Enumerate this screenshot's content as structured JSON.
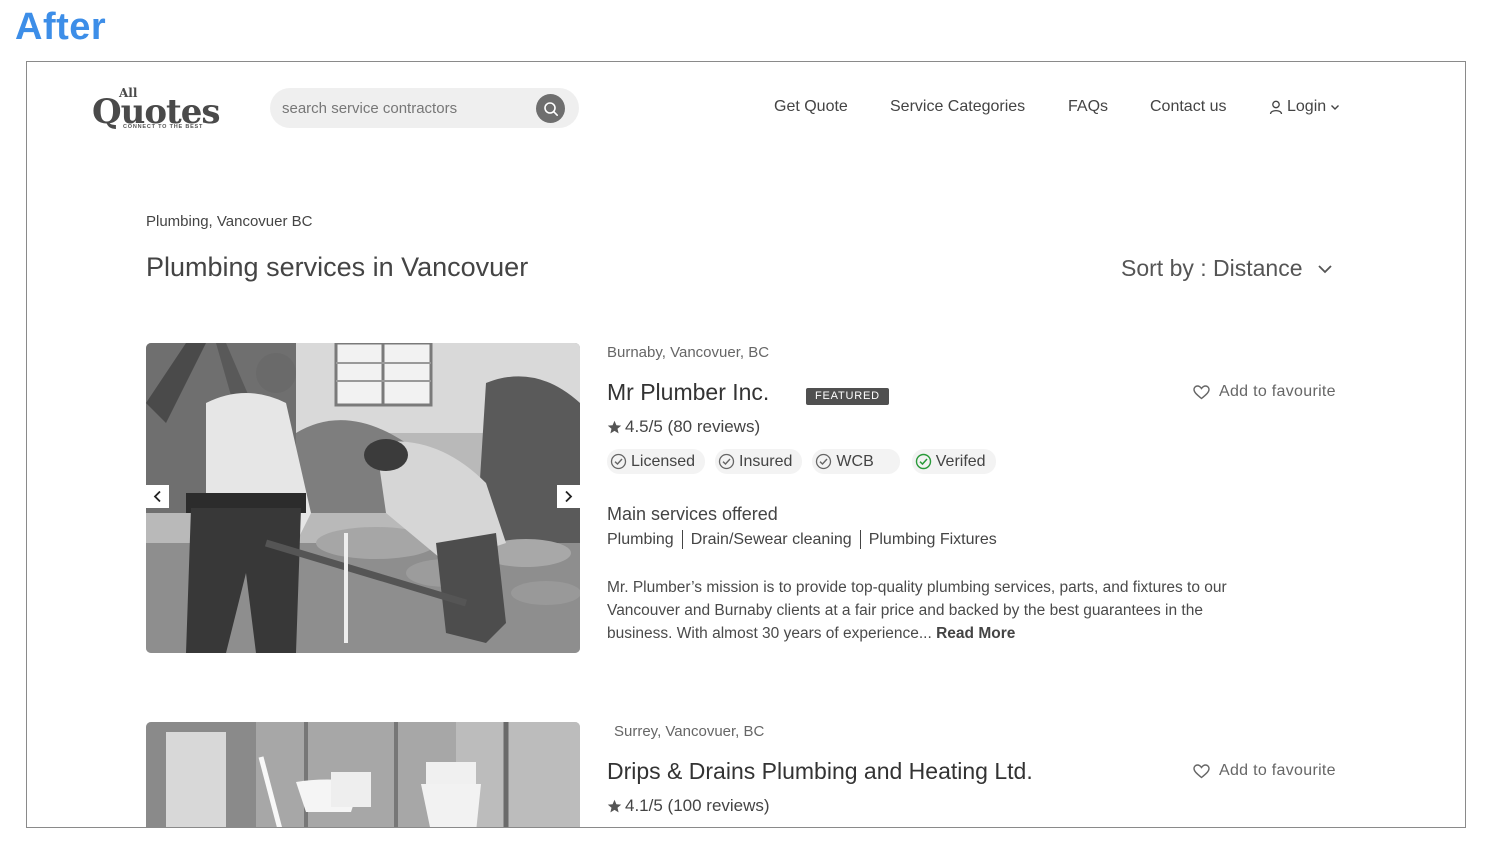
{
  "label": "After",
  "header": {
    "logo_top": "All",
    "logo_main": "Quotes",
    "logo_tagline": "CONNECT TO THE BEST",
    "search_placeholder": "search service contractors",
    "nav": [
      "Get Quote",
      "Service Categories",
      "FAQs",
      "Contact us"
    ],
    "login": "Login"
  },
  "page": {
    "breadcrumb": "Plumbing, Vancovuer BC",
    "title": "Plumbing services in Vancovuer",
    "sort": "Sort by : Distance"
  },
  "listings": [
    {
      "location": "Burnaby, Vancovuer, BC",
      "name": "Mr Plumber Inc.",
      "featured": "FEATURED",
      "rating": "4.5/5 (80 reviews)",
      "favourite": "Add to favourite",
      "badges": [
        {
          "label": "Licensed",
          "verified": false
        },
        {
          "label": "Insured",
          "verified": false
        },
        {
          "label": "WCB",
          "verified": false
        },
        {
          "label": "Verifed",
          "verified": true
        }
      ],
      "services_title": "Main services offered",
      "services": [
        "Plumbing",
        "Drain/Sewear cleaning",
        "Plumbing Fixtures"
      ],
      "description": "Mr. Plumber’s mission is to provide top-quality plumbing services, parts, and fixtures to our Vancouver and Burnaby clients at a fair price and backed by the best guarantees in the business. With almost 30 years of experience...",
      "read_more": "Read More"
    },
    {
      "location": "Surrey, Vancovuer, BC",
      "name": "Drips & Drains Plumbing and Heating Ltd.",
      "rating": "4.1/5 (100 reviews)",
      "favourite": "Add to favourite"
    }
  ],
  "colors": {
    "accent_label": "#3d8ee8",
    "verified_green": "#2a9a3a",
    "badge_dark": "#505050"
  }
}
